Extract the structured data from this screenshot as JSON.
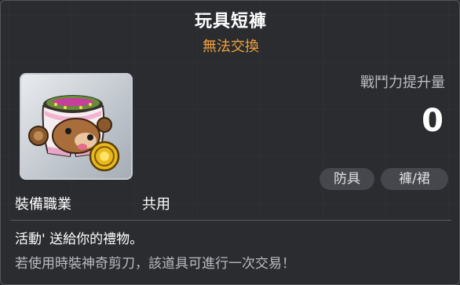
{
  "item": {
    "name": "玩具短褲",
    "trade_status": "無法交換",
    "icon": "toy-shorts-icon"
  },
  "stats": {
    "power_label": "戰鬥力提升量",
    "power_value": "0"
  },
  "tags": [
    "防具",
    "褲/裙"
  ],
  "requirements": {
    "job_label": "裝備職業",
    "job_value": "共用"
  },
  "description": {
    "line1": "活動' 送給你的禮物。",
    "line2": "若使用時裝神奇剪刀，該道具可進行一次交易！"
  },
  "colors": {
    "trade_status": "#f2a23a",
    "background": "#2b2c30"
  }
}
